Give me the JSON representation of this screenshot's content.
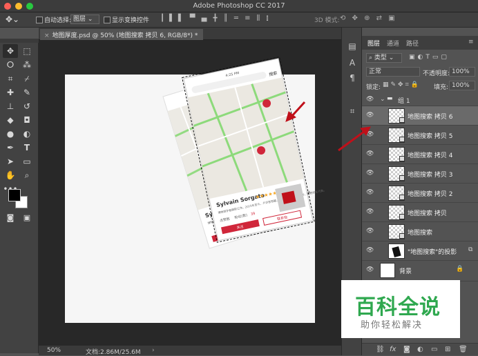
{
  "window": {
    "title": "Adobe Photoshop CC 2017"
  },
  "options_bar": {
    "auto_select_label": "自动选择:",
    "auto_select_value": "图层",
    "show_transform_label": "显示变换控件",
    "mode_3d_label": "3D 模式:"
  },
  "document_tab": {
    "label": "地图厚度.psd @ 50% (地图搜索 拷贝 6, RGB/8*) *"
  },
  "status_bar": {
    "zoom": "50%",
    "doc_size": "文档:2.86M/25.6M"
  },
  "mockup": {
    "time": "4:25 PM",
    "search_text": "搜索",
    "card_name": "Sylvain Sorgato",
    "card_desc": "博物馆学者摘取工作。2015年至今，卢浮宫馆藏，后者，2012-2015年，特别学生代表。",
    "card_stats_label": "点赞数",
    "card_count_label": "粉丝(数)",
    "card_count_value": "39",
    "btn_primary": "关注",
    "btn_secondary": "联系他"
  },
  "layers_panel": {
    "tabs": [
      "图层",
      "通道",
      "路径"
    ],
    "filter_label": "类型",
    "blend_mode": "正常",
    "opacity_label": "不透明度:",
    "opacity_value": "100%",
    "lock_label": "锁定:",
    "fill_label": "填充:",
    "fill_value": "100%",
    "group_name": "组 1",
    "layers": [
      {
        "name": "地图搜索 拷贝 6",
        "selected": true
      },
      {
        "name": "地图搜索 拷贝 5",
        "selected": false
      },
      {
        "name": "地图搜索 拷贝 4",
        "selected": false
      },
      {
        "name": "地图搜索 拷贝 3",
        "selected": false
      },
      {
        "name": "地图搜索 拷贝 2",
        "selected": false
      },
      {
        "name": "地图搜索 拷贝",
        "selected": false
      },
      {
        "name": "地图搜索",
        "selected": false
      },
      {
        "name": "\"地图搜索\"的投影",
        "selected": false
      }
    ],
    "background_layer": "背景"
  },
  "watermark": {
    "title": "百科全说",
    "subtitle": "助你轻松解决"
  },
  "colors": {
    "accent_red": "#d0263a",
    "annotation_red": "#c0101a",
    "map_green": "#7dd86a",
    "watermark_green": "#2fa84f"
  },
  "icons": [
    "move-icon",
    "marquee-icon",
    "lasso-icon",
    "magic-wand-icon",
    "crop-icon",
    "eyedropper-icon",
    "healing-icon",
    "brush-icon",
    "stamp-icon",
    "history-brush-icon",
    "eraser-icon",
    "bucket-icon",
    "blur-icon",
    "dodge-icon",
    "pen-icon",
    "type-icon",
    "path-select-icon",
    "rectangle-icon",
    "hand-icon",
    "zoom-icon",
    "eye-icon",
    "folder-icon",
    "lock-icon"
  ]
}
